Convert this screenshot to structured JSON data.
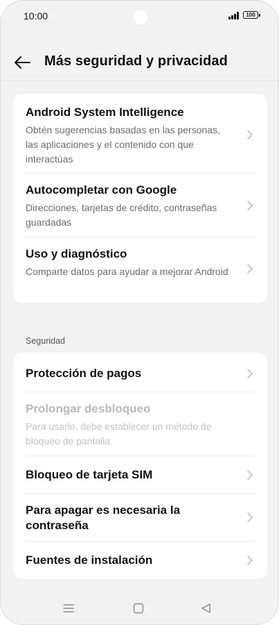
{
  "status_bar": {
    "time": "10:00",
    "battery": "100"
  },
  "header": {
    "title": "Más seguridad y privacidad"
  },
  "cards": [
    {
      "items": [
        {
          "title": "Android System Intelligence",
          "subtitle": "Obtén sugerencias basadas en las personas, las aplicaciones y el contenido con que interactúas"
        },
        {
          "title": "Autocompletar con Google",
          "subtitle": "Direcciones, tarjetas de crédito, contraseñas guardadas"
        },
        {
          "title": "Uso y diagnóstico",
          "subtitle": "Comparte datos para ayudar a mejorar Android"
        }
      ]
    },
    {
      "section": "Seguridad",
      "items": [
        {
          "title": "Protección de pagos"
        },
        {
          "title": "Prolongar desbloqueo",
          "subtitle": "Para usarlo, debe establecer un método de bloqueo de pantalla",
          "disabled": true
        },
        {
          "title": "Bloqueo de tarjeta SIM"
        },
        {
          "title": "Para apagar es necesaria la contraseña"
        },
        {
          "title": "Fuentes de instalación"
        }
      ]
    }
  ],
  "colors": {
    "background": "#f2f2f2",
    "card": "#ffffff",
    "text": "#111111",
    "secondary_text": "#6b6b6b",
    "disabled_text": "#b9b9b9"
  },
  "icons": {
    "back": "arrow-left-icon",
    "chevron": "chevron-right-icon",
    "nav_menu": "menu-icon",
    "nav_home": "home-icon",
    "nav_back": "triangle-back-icon"
  }
}
